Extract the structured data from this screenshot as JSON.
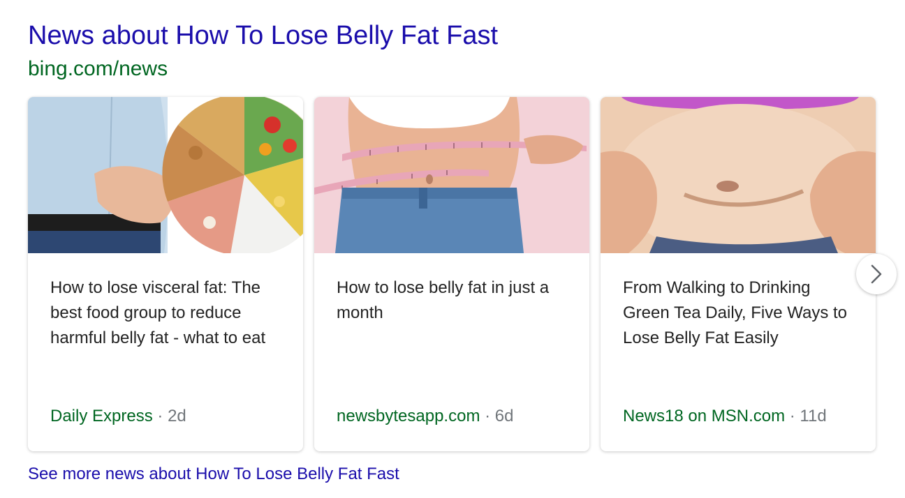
{
  "header": {
    "title": "News about How To Lose Belly Fat Fast",
    "url": "bing.com/news"
  },
  "cards": [
    {
      "title": "How to lose visceral fat: The best food group to reduce harmful belly fat - what to eat",
      "source": "Daily Express",
      "age": "2d",
      "image": "man-belly-with-food-wheel-photo"
    },
    {
      "title": "How to lose belly fat in just a month",
      "source": "newsbytesapp.com",
      "age": "6d",
      "image": "waist-measuring-tape-photo"
    },
    {
      "title": "From Walking to Drinking Green Tea Daily, Five Ways to Lose Belly Fat Easily",
      "source": "News18 on MSN.com",
      "age": "11d",
      "image": "hands-pinching-belly-photo"
    }
  ],
  "separator": "·",
  "next_icon": "chevron-right-icon",
  "see_more": "See more news about How To Lose Belly Fat Fast",
  "colors": {
    "title_link": "#1a0dab",
    "url_green": "#006621",
    "meta_gray": "#70757a",
    "text_dark": "#222222"
  }
}
